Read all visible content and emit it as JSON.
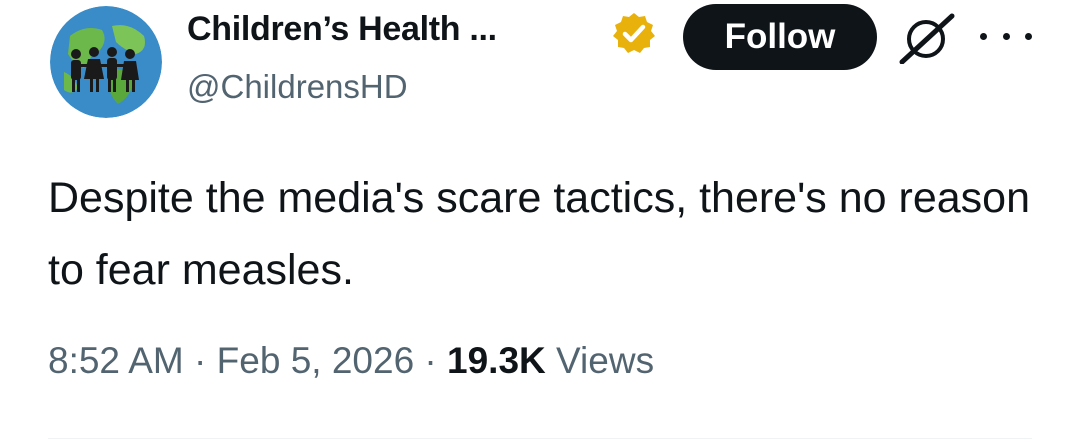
{
  "account": {
    "display_name": "Children’s Health ...",
    "handle": "@ChildrensHD",
    "verified": true,
    "badge_color": "#e8b10c"
  },
  "actions": {
    "follow_label": "Follow",
    "grok_icon": "grok-icon",
    "more_icon": "more-horizontal-icon"
  },
  "tweet": {
    "text": "Despite the media's scare tactics, there's no reason to fear measles."
  },
  "meta": {
    "time": "8:52 AM",
    "separator": "·",
    "date": "Feb 5, 2026",
    "views_count": "19.3K",
    "views_label": "Views"
  },
  "colors": {
    "text_primary": "#0f1419",
    "text_secondary": "#536471",
    "follow_bg": "#0f1419"
  }
}
